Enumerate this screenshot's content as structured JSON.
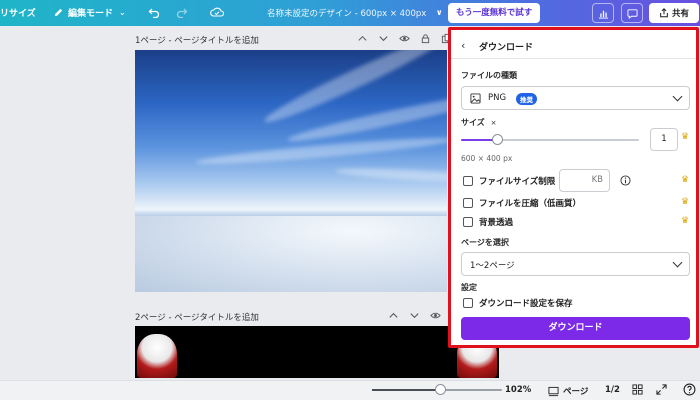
{
  "topbar": {
    "resize_label": "リサイズ",
    "edit_mode_label": "編集モード",
    "title": "名称未設定のデザイン - 600px × 400px",
    "trial_button": "もう一度無料で試す",
    "share_button": "共有"
  },
  "canvas": {
    "page1_label": "1ページ - ページタイトルを追加",
    "page2_label": "2ページ - ページタイトルを追加"
  },
  "bottombar": {
    "zoom_level": "102%",
    "zoom_fraction": 0.52,
    "pages_label": "ページ",
    "page_count": "1/2"
  },
  "download_panel": {
    "title": "ダウンロード",
    "file_type_label": "ファイルの種類",
    "file_type_value": "PNG",
    "file_type_badge": "推奨",
    "size_label": "サイズ",
    "size_multiplier": "×",
    "size_value": "1",
    "size_fraction": 0.2,
    "dimensions": "600 × 400 px",
    "file_size_limit_label": "ファイルサイズ制限",
    "kb_unit": "KB",
    "compress_label": "ファイルを圧縮（低画質）",
    "transparent_label": "背景透過",
    "page_select_label": "ページを選択",
    "page_select_value": "1〜2ページ",
    "settings_label": "設定",
    "save_settings_label": "ダウンロード設定を保存",
    "download_button": "ダウンロード"
  },
  "colors": {
    "accent": "#7d2ae8",
    "highlight_border": "#e0101d",
    "badge": "#1f63e8",
    "crown": "#e0a300"
  }
}
